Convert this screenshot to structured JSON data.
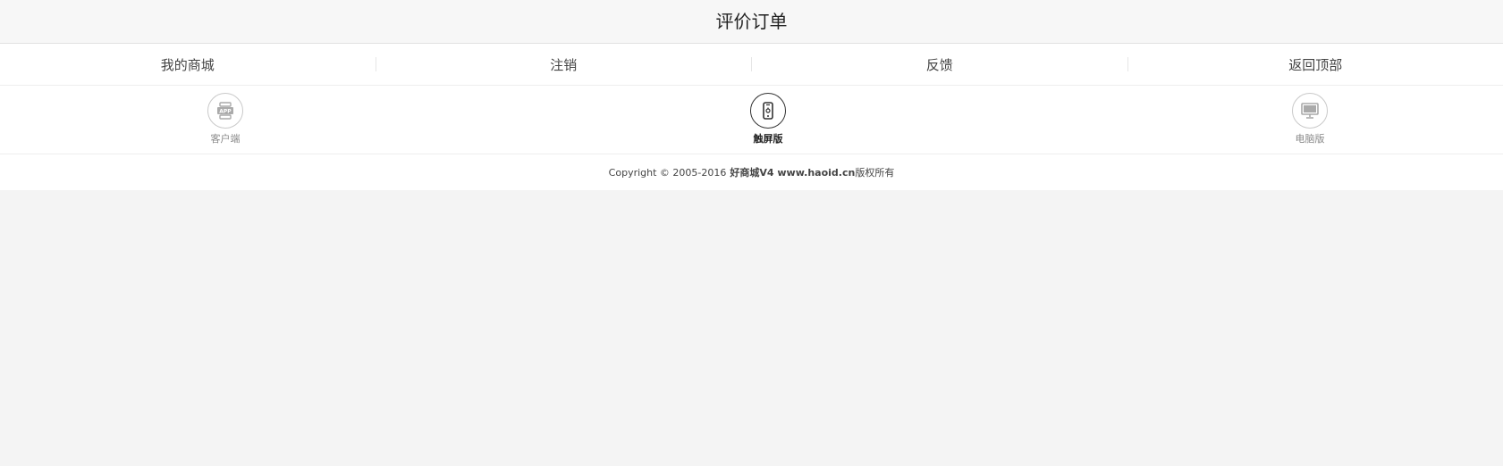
{
  "header": {
    "title": "评价订单"
  },
  "footer_nav": {
    "items": [
      {
        "label": "我的商城"
      },
      {
        "label": "注销"
      },
      {
        "label": "反馈"
      },
      {
        "label": "返回顶部"
      }
    ]
  },
  "versions": {
    "items": [
      {
        "label": "客户端",
        "icon": "app-icon",
        "active": false
      },
      {
        "label": "触屏版",
        "icon": "mobile-icon",
        "active": true
      },
      {
        "label": "电脑版",
        "icon": "desktop-icon",
        "active": false
      }
    ]
  },
  "copyright": {
    "prefix": "Copyright © 2005-2016",
    "brand": "好商城V4 www.haoid.cn",
    "suffix": "版权所有"
  },
  "colors": {
    "page_bg": "#f4f4f4",
    "header_bg": "#f7f7f7",
    "panel_bg": "#ffffff",
    "active_text": "#222222",
    "muted_text": "#8a8a8a"
  }
}
